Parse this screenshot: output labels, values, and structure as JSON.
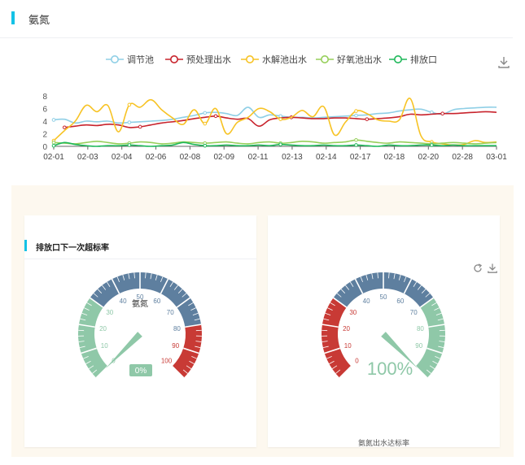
{
  "section": {
    "title": "氨氮"
  },
  "colors": {
    "accent": "#13c2e6",
    "gauge_blue": "#5e7f9f",
    "gauge_green": "#8fc8a8",
    "gauge_red": "#c83a35",
    "series": [
      "#8fcfe6",
      "#c8232c",
      "#f7c325",
      "#96cf5a",
      "#1fb85a"
    ]
  },
  "chart_data": {
    "type": "line",
    "legend_position": "top-center",
    "x_tick_labels": [
      "02-01",
      "02-03",
      "02-04",
      "02-06",
      "02-08",
      "02-09",
      "02-11",
      "02-13",
      "02-14",
      "02-17",
      "02-18",
      "02-20",
      "02-28",
      "03-01"
    ],
    "ylim": [
      0,
      8
    ],
    "y_ticks": [
      0,
      2,
      4,
      6,
      8
    ],
    "grid": false,
    "series": [
      {
        "name": "调节池",
        "values": [
          4.2,
          4.3,
          3.7,
          4.0,
          3.9,
          4.0,
          3.7,
          3.8,
          3.9,
          4.0,
          4.1,
          4.3,
          4.6,
          4.9,
          5.3,
          5.4,
          5.2,
          4.9,
          6.2,
          4.6,
          5.0,
          4.8,
          4.6,
          4.6,
          4.5,
          4.6,
          4.7,
          4.8,
          4.9,
          5.0,
          5.2,
          5.3,
          5.6,
          5.8,
          5.9,
          5.4,
          5.1,
          5.8,
          6.0,
          6.1,
          6.2,
          6.2
        ]
      },
      {
        "name": "预处理出水",
        "values": [
          null,
          3.0,
          3.2,
          3.4,
          3.3,
          3.5,
          3.4,
          3.0,
          3.1,
          3.4,
          3.7,
          3.9,
          4.1,
          4.4,
          4.6,
          4.8,
          4.5,
          4.3,
          4.4,
          3.2,
          4.2,
          4.5,
          4.6,
          4.5,
          4.4,
          4.4,
          4.5,
          4.5,
          4.4,
          4.3,
          4.4,
          4.5,
          4.7,
          5.1,
          5.0,
          5.1,
          5.2,
          5.2,
          5.3,
          5.4,
          5.5,
          5.4
        ]
      },
      {
        "name": "水解池出水",
        "values": [
          0.9,
          2.5,
          4.0,
          6.5,
          5.5,
          6.5,
          2.3,
          6.6,
          6.2,
          7.4,
          5.8,
          4.5,
          3.5,
          5.8,
          3.6,
          6.0,
          2.0,
          3.8,
          4.6,
          6.0,
          5.5,
          4.3,
          4.6,
          5.7,
          4.7,
          6.3,
          1.8,
          3.8,
          5.6,
          5.2,
          4.2,
          4.0,
          4.2,
          7.6,
          1.7,
          0.7,
          0.4,
          0.2,
          0.3,
          0.9,
          0.6,
          0.7
        ]
      },
      {
        "name": "好氧池出水",
        "values": [
          0.6,
          0.5,
          0.4,
          0.6,
          0.8,
          0.6,
          0.4,
          0.5,
          0.7,
          0.6,
          0.4,
          0.5,
          0.7,
          0.6,
          0.5,
          0.6,
          0.7,
          0.5,
          0.4,
          0.6,
          0.7,
          0.5,
          0.6,
          0.8,
          0.7,
          0.5,
          0.6,
          0.7,
          1.0,
          0.8,
          0.6,
          0.5,
          0.7,
          0.6,
          0.5,
          0.4,
          0.5,
          0.6,
          0.5,
          0.4,
          0.5,
          0.6
        ]
      },
      {
        "name": "排放口",
        "values": [
          0.1,
          0.6,
          0.3,
          0.1,
          0.0,
          0.1,
          0.1,
          0.2,
          0.1,
          0.0,
          0.1,
          0.2,
          0.6,
          0.3,
          0.1,
          0.1,
          0.2,
          0.1,
          0.1,
          0.2,
          0.1,
          0.3,
          0.2,
          0.1,
          0.1,
          0.2,
          0.1,
          0.1,
          0.2,
          0.1,
          0.0,
          0.2,
          0.1,
          0.1,
          0.2,
          0.2,
          0.1,
          0.2,
          0.1,
          0.1,
          0.1,
          0.1
        ]
      }
    ]
  },
  "gauge_left": {
    "title": "排放口下一次超标率",
    "name": "氨氮",
    "value": 0,
    "value_label": "0%",
    "ticks": [
      "0",
      "10",
      "20",
      "30",
      "40",
      "50",
      "60",
      "70",
      "80",
      "90",
      "100"
    ],
    "bands": [
      {
        "to": 0.3,
        "color": "#8fc8a8"
      },
      {
        "to": 0.8,
        "color": "#5e7f9f"
      },
      {
        "to": 1.0,
        "color": "#c83a35"
      }
    ]
  },
  "gauge_right": {
    "caption": "氨氮出水达标率",
    "value": 1.0,
    "value_label": "100%",
    "ticks": [
      "0",
      "10",
      "20",
      "30",
      "40",
      "50",
      "60",
      "70",
      "80",
      "90"
    ],
    "bands": [
      {
        "to": 0.3,
        "color": "#c83a35"
      },
      {
        "to": 0.7,
        "color": "#5e7f9f"
      },
      {
        "to": 1.0,
        "color": "#8fc8a8"
      }
    ]
  },
  "icons": {
    "download": "download-icon",
    "refresh": "refresh-icon"
  }
}
